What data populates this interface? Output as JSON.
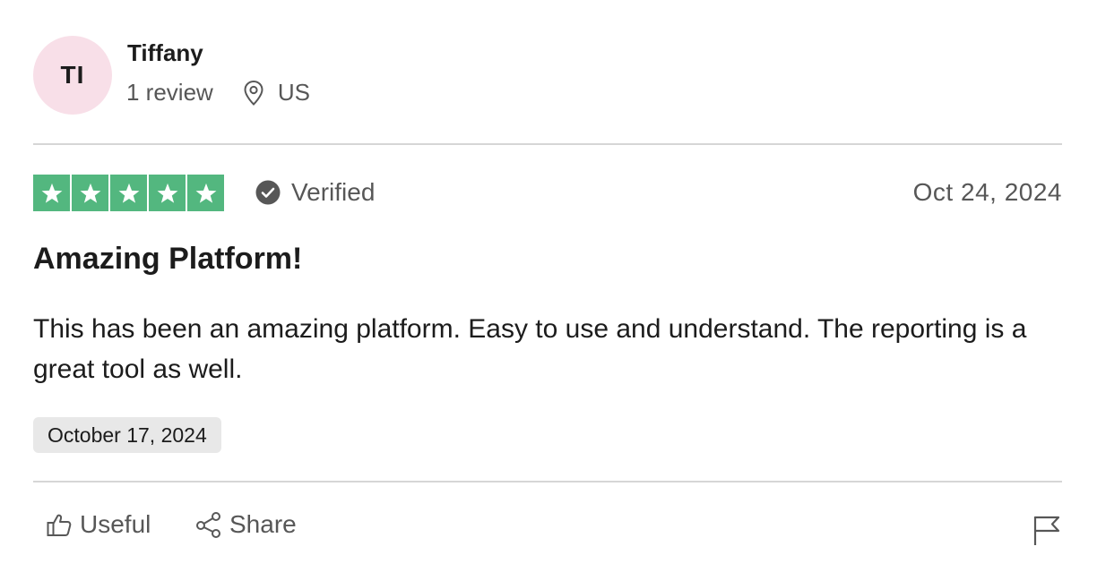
{
  "reviewer": {
    "initials": "TI",
    "name": "Tiffany",
    "review_count": "1 review",
    "location": "US",
    "avatar_color": "#f8dfe8"
  },
  "review": {
    "rating": 5,
    "max_rating": 5,
    "star_color": "#53b77f",
    "verified_label": "Verified",
    "date_posted": "Oct 24, 2024",
    "title": "Amazing Platform!",
    "body": "This has been an amazing platform. Easy to use and understand. The reporting is a great tool as well.",
    "experience_date": "October 17, 2024"
  },
  "actions": {
    "useful_label": "Useful",
    "share_label": "Share",
    "report_icon": "flag-icon"
  }
}
